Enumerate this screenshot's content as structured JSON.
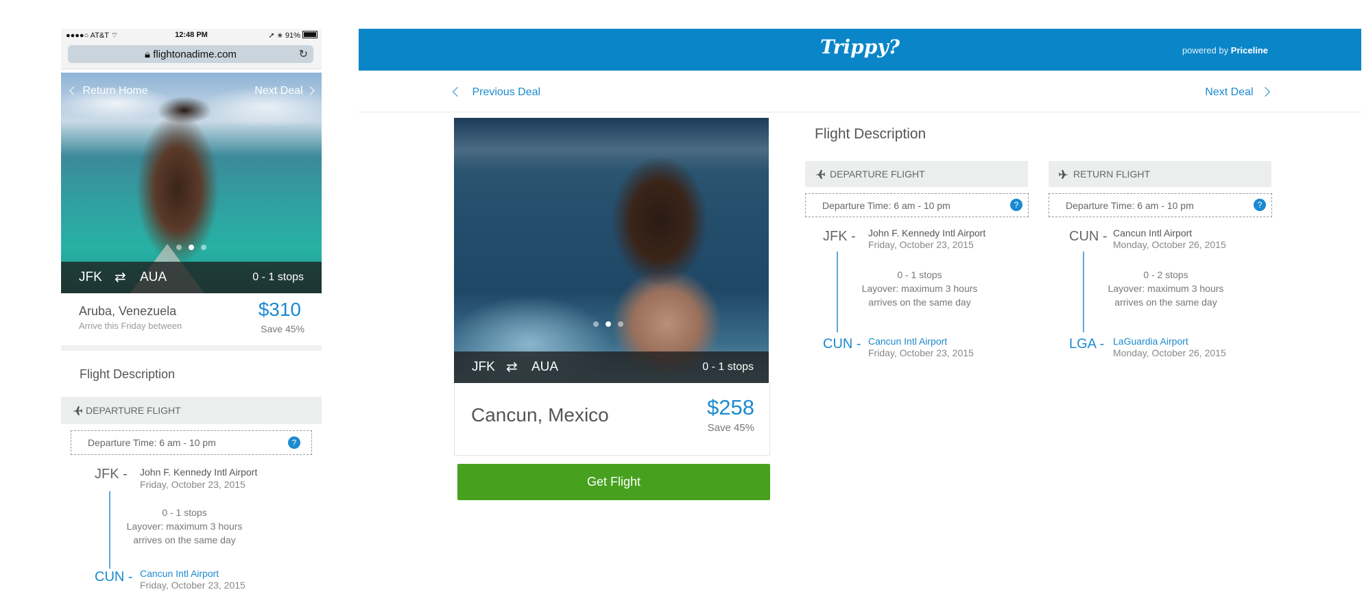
{
  "mobile": {
    "status_bar": {
      "carrier": "●●●●○ AT&T",
      "time": "12:48 PM",
      "battery": "91%"
    },
    "url": "flightonadime.com",
    "nav": {
      "back_label": "Return Home",
      "next_label": "Next Deal"
    },
    "carousel": {
      "count": 3,
      "active_index": 1
    },
    "route": {
      "from": "JFK",
      "to": "AUA",
      "stops": "0 - 1 stops"
    },
    "deal": {
      "destination": "Aruba, Venezuela",
      "subtitle": "Arrive this Friday between",
      "price": "$310",
      "savings": "Save 45%"
    },
    "flight_description_title": "Flight Description",
    "departure": {
      "header": "DEPARTURE FLIGHT",
      "time_window": "Departure Time: 6 am - 10 pm",
      "help": "?",
      "origin_code": "JFK -",
      "origin_airport": "John F. Kennedy Intl Airport",
      "origin_date": "Friday, October 23, 2015",
      "stops": "0 - 1 stops",
      "layover": "Layover: maximum 3 hours",
      "arrival_note": "arrives on the same day",
      "dest_code": "CUN -",
      "dest_airport": "Cancun Intl Airport",
      "dest_date": "Friday, October 23, 2015"
    }
  },
  "desktop": {
    "brand": "Trippy?",
    "powered_by_prefix": "powered by",
    "powered_by_brand": "Priceline",
    "nav": {
      "prev_label": "Previous Deal",
      "next_label": "Next Deal"
    },
    "carousel": {
      "count": 3,
      "active_index": 1
    },
    "route": {
      "from": "JFK",
      "to": "AUA",
      "stops": "0 - 1 stops"
    },
    "deal": {
      "destination": "Cancun, Mexico",
      "price": "$258",
      "savings": "Save 45%"
    },
    "cta_label": "Get Flight",
    "flight_description_title": "Flight Description",
    "departure": {
      "header": "DEPARTURE FLIGHT",
      "time_window": "Departure Time: 6 am - 10 pm",
      "help": "?",
      "origin_code": "JFK -",
      "origin_airport": "John F. Kennedy Intl Airport",
      "origin_date": "Friday, October 23, 2015",
      "stops": "0 - 1 stops",
      "layover": "Layover: maximum 3 hours",
      "arrival_note": "arrives on the same day",
      "dest_code": "CUN -",
      "dest_airport": "Cancun Intl Airport",
      "dest_date": "Friday, October 23, 2015"
    },
    "return": {
      "header": "RETURN FLIGHT",
      "time_window": "Departure Time: 6 am - 10 pm",
      "help": "?",
      "origin_code": "CUN -",
      "origin_airport": "Cancun Intl Airport",
      "origin_date": "Monday, October 26, 2015",
      "stops": "0 - 2 stops",
      "layover": "Layover: maximum 3 hours",
      "arrival_note": "arrives on the same day",
      "dest_code": "LGA -",
      "dest_airport": "LaGuardia Airport",
      "dest_date": "Monday, October 26, 2015"
    }
  },
  "colors": {
    "brand_blue": "#0a86c8",
    "link_blue": "#1b8ad0",
    "cta_green": "#47a11f",
    "header_gray": "#eceeee"
  },
  "icons": [
    "wifi-icon",
    "lock-icon",
    "reload-icon",
    "chevron-left-icon",
    "chevron-right-icon",
    "round-trip-icon",
    "plane-icon",
    "help-icon",
    "battery-icon"
  ]
}
